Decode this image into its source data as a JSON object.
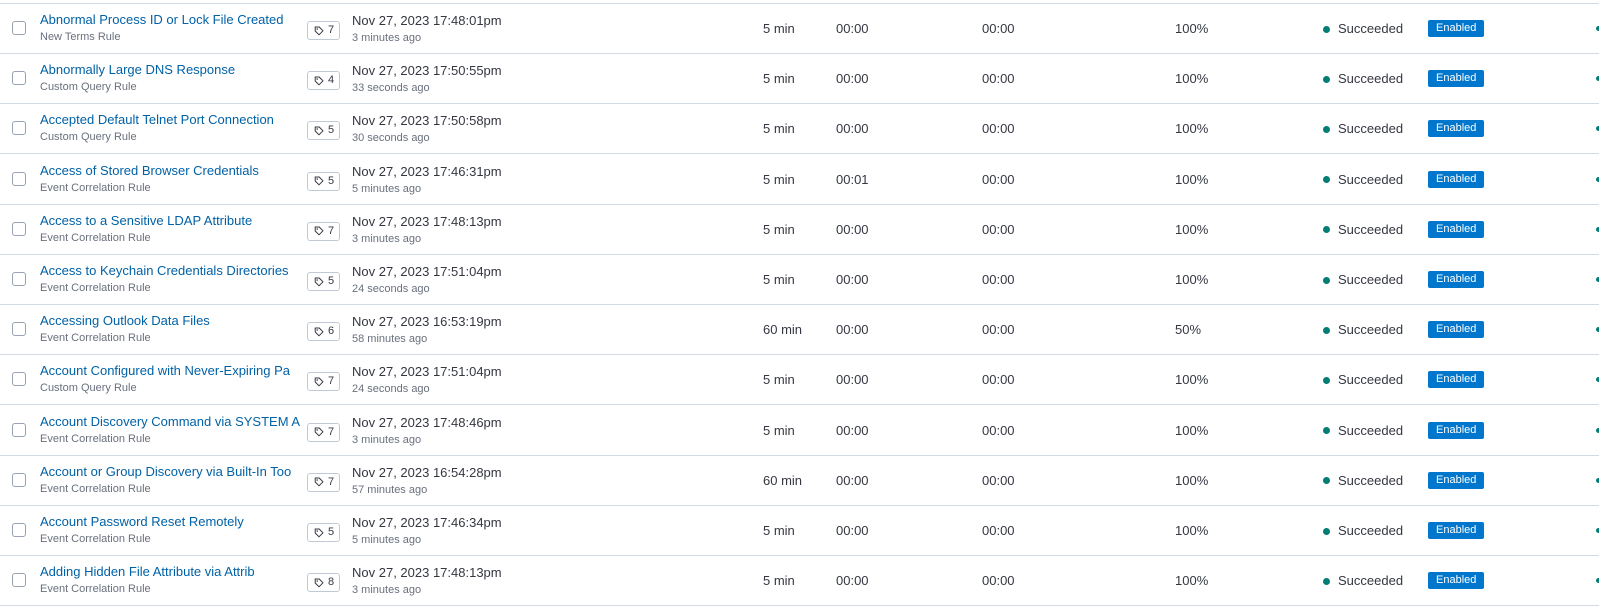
{
  "colors": {
    "link": "#0061a6",
    "status_success": "#017d73",
    "enabled_badge": "#0077cc",
    "row_border": "#d3dae6"
  },
  "icons": {
    "tag": "tag-icon",
    "status": "status-dot"
  },
  "rows": [
    {
      "name": "Abnormal Process ID or Lock File Created",
      "type": "New Terms Rule",
      "tags": "7",
      "last_run": "Nov 27, 2023 17:48:01pm",
      "last_run_rel": "3 minutes ago",
      "interval": "5 min",
      "indexing": "00:00",
      "query": "00:00",
      "coverage": "100%",
      "status": "Succeeded",
      "enabled": "Enabled"
    },
    {
      "name": "Abnormally Large DNS Response",
      "type": "Custom Query Rule",
      "tags": "4",
      "last_run": "Nov 27, 2023 17:50:55pm",
      "last_run_rel": "33 seconds ago",
      "interval": "5 min",
      "indexing": "00:00",
      "query": "00:00",
      "coverage": "100%",
      "status": "Succeeded",
      "enabled": "Enabled"
    },
    {
      "name": "Accepted Default Telnet Port Connection",
      "type": "Custom Query Rule",
      "tags": "5",
      "last_run": "Nov 27, 2023 17:50:58pm",
      "last_run_rel": "30 seconds ago",
      "interval": "5 min",
      "indexing": "00:00",
      "query": "00:00",
      "coverage": "100%",
      "status": "Succeeded",
      "enabled": "Enabled"
    },
    {
      "name": "Access of Stored Browser Credentials",
      "type": "Event Correlation Rule",
      "tags": "5",
      "last_run": "Nov 27, 2023 17:46:31pm",
      "last_run_rel": "5 minutes ago",
      "interval": "5 min",
      "indexing": "00:01",
      "query": "00:00",
      "coverage": "100%",
      "status": "Succeeded",
      "enabled": "Enabled"
    },
    {
      "name": "Access to a Sensitive LDAP Attribute",
      "type": "Event Correlation Rule",
      "tags": "7",
      "last_run": "Nov 27, 2023 17:48:13pm",
      "last_run_rel": "3 minutes ago",
      "interval": "5 min",
      "indexing": "00:00",
      "query": "00:00",
      "coverage": "100%",
      "status": "Succeeded",
      "enabled": "Enabled"
    },
    {
      "name": "Access to Keychain Credentials Directories",
      "type": "Event Correlation Rule",
      "tags": "5",
      "last_run": "Nov 27, 2023 17:51:04pm",
      "last_run_rel": "24 seconds ago",
      "interval": "5 min",
      "indexing": "00:00",
      "query": "00:00",
      "coverage": "100%",
      "status": "Succeeded",
      "enabled": "Enabled"
    },
    {
      "name": "Accessing Outlook Data Files",
      "type": "Event Correlation Rule",
      "tags": "6",
      "last_run": "Nov 27, 2023 16:53:19pm",
      "last_run_rel": "58 minutes ago",
      "interval": "60 min",
      "indexing": "00:00",
      "query": "00:00",
      "coverage": "50%",
      "status": "Succeeded",
      "enabled": "Enabled"
    },
    {
      "name": "Account Configured with Never-Expiring Pa",
      "type": "Custom Query Rule",
      "tags": "7",
      "last_run": "Nov 27, 2023 17:51:04pm",
      "last_run_rel": "24 seconds ago",
      "interval": "5 min",
      "indexing": "00:00",
      "query": "00:00",
      "coverage": "100%",
      "status": "Succeeded",
      "enabled": "Enabled"
    },
    {
      "name": "Account Discovery Command via SYSTEM A",
      "type": "Event Correlation Rule",
      "tags": "7",
      "last_run": "Nov 27, 2023 17:48:46pm",
      "last_run_rel": "3 minutes ago",
      "interval": "5 min",
      "indexing": "00:00",
      "query": "00:00",
      "coverage": "100%",
      "status": "Succeeded",
      "enabled": "Enabled"
    },
    {
      "name": "Account or Group Discovery via Built-In Too",
      "type": "Event Correlation Rule",
      "tags": "7",
      "last_run": "Nov 27, 2023 16:54:28pm",
      "last_run_rel": "57 minutes ago",
      "interval": "60 min",
      "indexing": "00:00",
      "query": "00:00",
      "coverage": "100%",
      "status": "Succeeded",
      "enabled": "Enabled"
    },
    {
      "name": "Account Password Reset Remotely",
      "type": "Event Correlation Rule",
      "tags": "5",
      "last_run": "Nov 27, 2023 17:46:34pm",
      "last_run_rel": "5 minutes ago",
      "interval": "5 min",
      "indexing": "00:00",
      "query": "00:00",
      "coverage": "100%",
      "status": "Succeeded",
      "enabled": "Enabled"
    },
    {
      "name": "Adding Hidden File Attribute via Attrib",
      "type": "Event Correlation Rule",
      "tags": "8",
      "last_run": "Nov 27, 2023 17:48:13pm",
      "last_run_rel": "3 minutes ago",
      "interval": "5 min",
      "indexing": "00:00",
      "query": "00:00",
      "coverage": "100%",
      "status": "Succeeded",
      "enabled": "Enabled"
    }
  ]
}
